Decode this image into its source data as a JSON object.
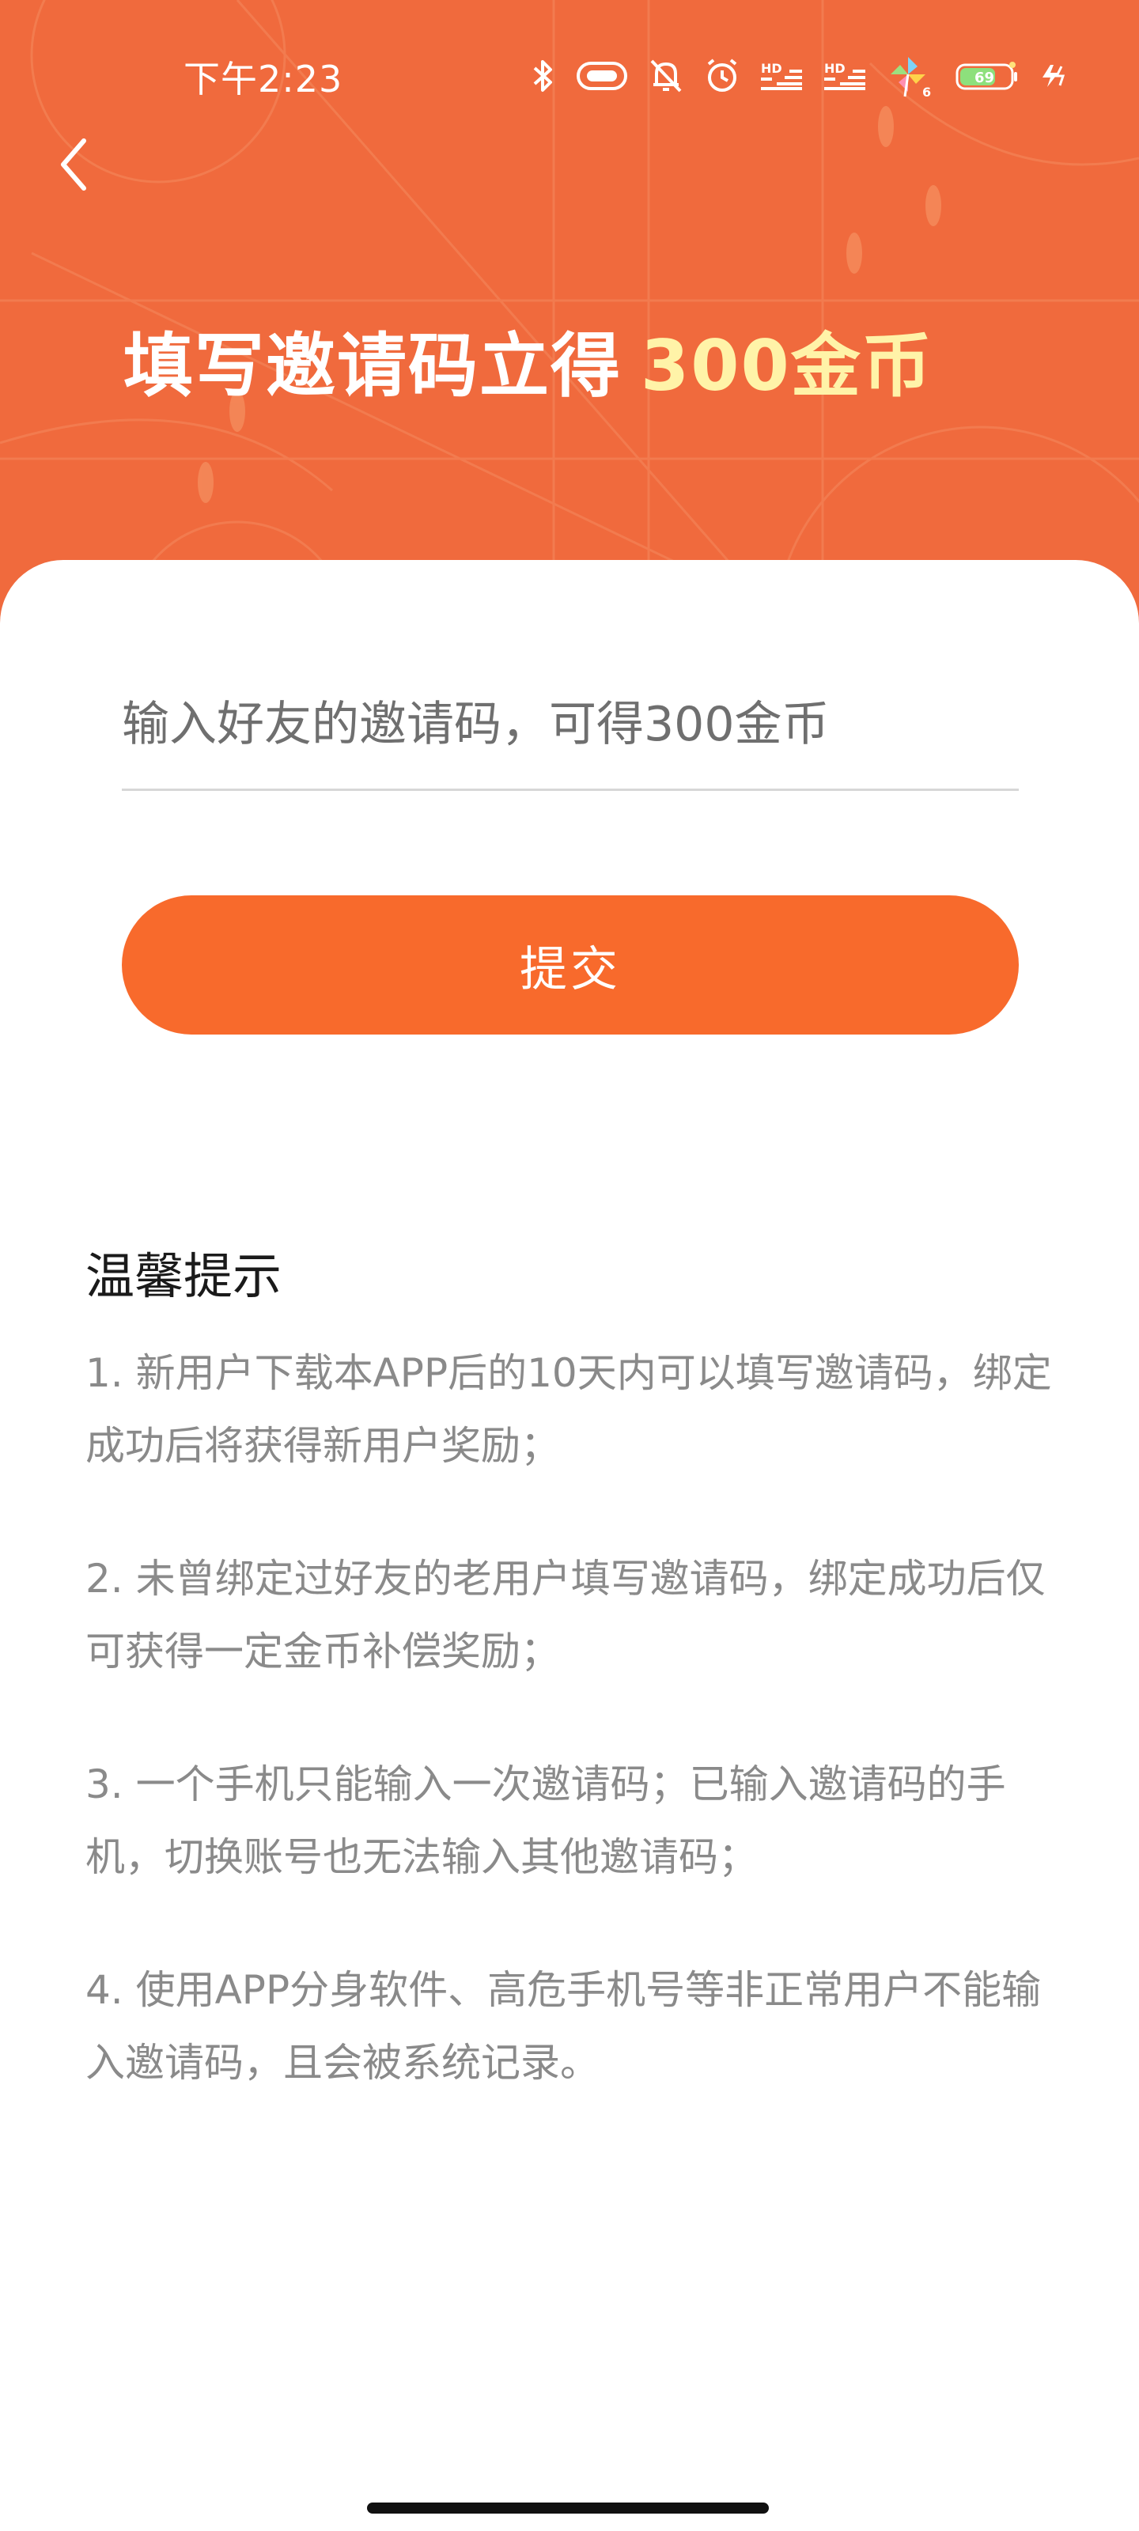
{
  "status_bar": {
    "time": "下午2:23",
    "hd_label_1": "HD",
    "hd_label_2": "HD",
    "battery": "69",
    "icons": [
      "bluetooth-icon",
      "vibrate-icon",
      "mute-bell-icon",
      "alarm-icon",
      "hd-signal-icon",
      "hd-signal-icon",
      "pinwheel-icon",
      "battery-icon",
      "charging-icon"
    ]
  },
  "header": {
    "back_icon": "chevron-left-icon",
    "title_main": "填写邀请码立得",
    "title_highlight": "300金币"
  },
  "form": {
    "input_placeholder": "输入好友的邀请码，可得300金币",
    "input_value": "",
    "submit_label": "提交"
  },
  "tips": {
    "title": "温馨提示",
    "items": [
      "1. 新用户下载本APP后的10天内可以填写邀请码，绑定成功后将获得新用户奖励；",
      "2. 未曾绑定过好友的老用户填写邀请码，绑定成功后仅可获得一定金币补偿奖励；",
      "3. 一个手机只能输入一次邀请码；已输入邀请码的手机，切换账号也无法输入其他邀请码；",
      "4. 使用APP分身软件、高危手机号等非正常用户不能输入邀请码，且会被系统记录。"
    ]
  },
  "colors": {
    "header_bg": "#f06a3d",
    "highlight": "#fff3a8",
    "button": "#f86a2c",
    "tip_text": "#8a8a8a"
  }
}
